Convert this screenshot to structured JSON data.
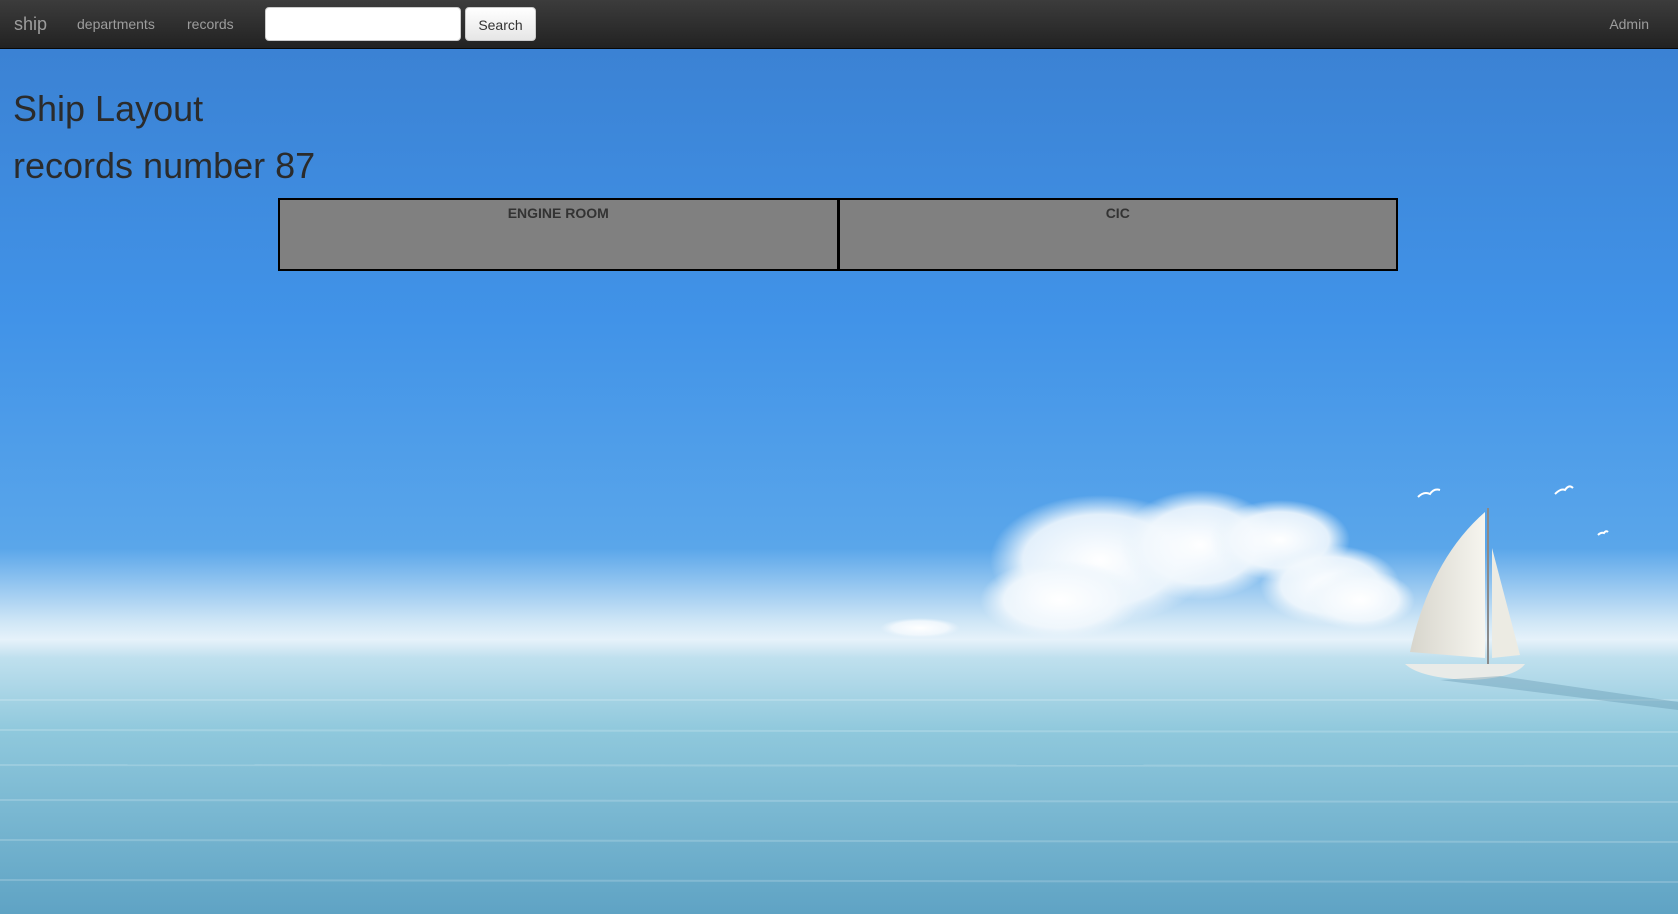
{
  "navbar": {
    "brand": "ship",
    "links": [
      "departments",
      "records"
    ],
    "search": {
      "value": "",
      "placeholder": "",
      "button_label": "Search"
    },
    "user": "Admin"
  },
  "page": {
    "title": "Ship Layout",
    "records_label": "records number 87"
  },
  "rooms": [
    {
      "name": "ENGINE ROOM"
    },
    {
      "name": "CIC"
    }
  ],
  "colors": {
    "navbar": "#222222",
    "room_fill": "#808080",
    "room_border": "#000000",
    "sky": "#3f8fe0",
    "sea": "#7fbfd6"
  }
}
